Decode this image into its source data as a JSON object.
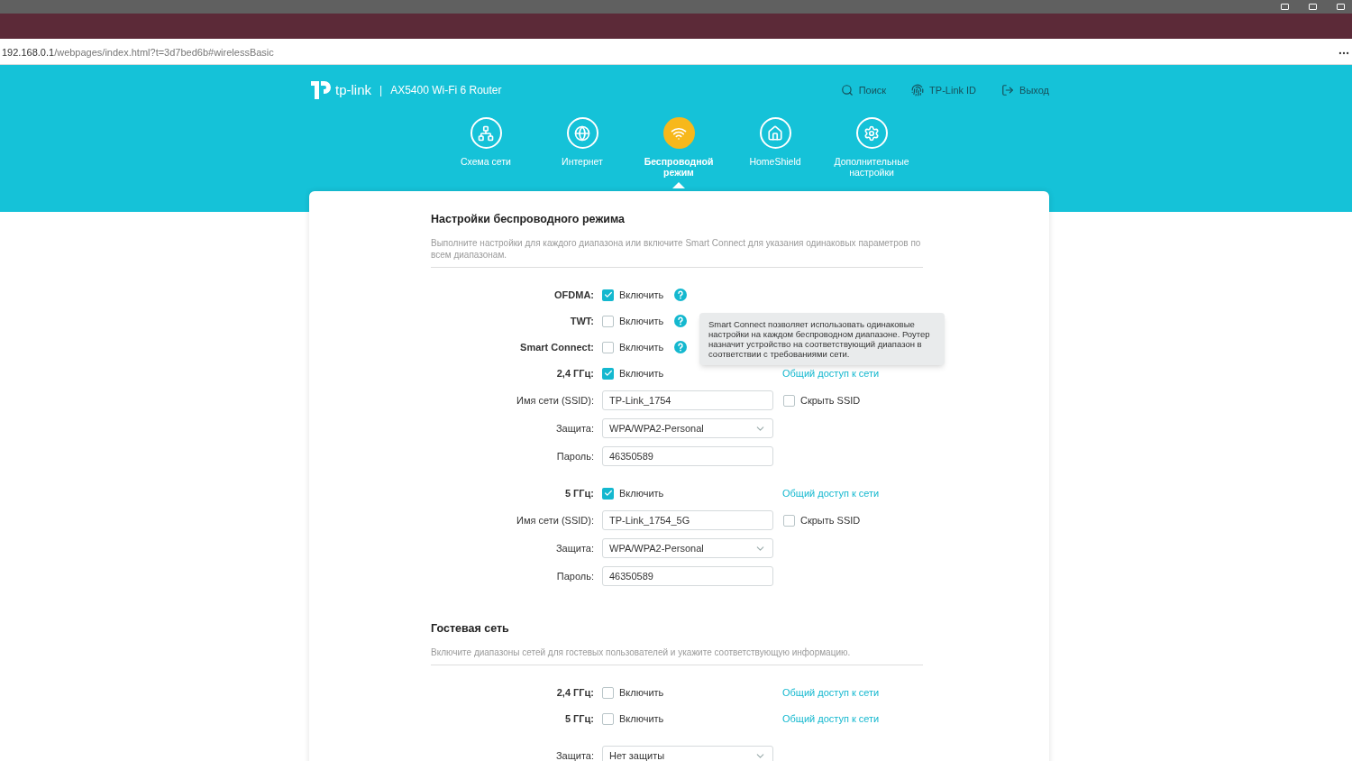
{
  "browser": {
    "url_host": "192.168.0.1",
    "url_path": "/webpages/index.html?t=3d7bed6b#wirelessBasic"
  },
  "header": {
    "logo_text": "tp-link",
    "separator": "|",
    "model": "AX5400 Wi-Fi 6 Router",
    "actions": [
      {
        "kind": "search",
        "label": "Поиск"
      },
      {
        "kind": "id",
        "label": "TP-Link ID"
      },
      {
        "kind": "logout",
        "label": "Выход"
      }
    ]
  },
  "nav": [
    {
      "kind": "network",
      "label": "Схема сети",
      "selected": false
    },
    {
      "kind": "internet",
      "label": "Интернет",
      "selected": false
    },
    {
      "kind": "wireless",
      "label": "Беспроводной режим",
      "selected": true
    },
    {
      "kind": "homeshield",
      "label": "HomeShield",
      "selected": false
    },
    {
      "kind": "advanced",
      "label": "Дополнительные настройки",
      "selected": false
    }
  ],
  "sections": [
    {
      "title": "Настройки беспроводного режима",
      "description": "Выполните настройки для каждого диапазона или включите Smart Connect для указания одинаковых параметров по всем диапазонам.",
      "groups": [
        [
          {
            "kind": "checkbox",
            "label": "OFDMA:",
            "checked": true,
            "option": "Включить",
            "help": true
          },
          {
            "kind": "checkbox",
            "label": "TWT:",
            "checked": false,
            "option": "Включить",
            "help": true
          },
          {
            "kind": "checkbox",
            "label": "Smart Connect:",
            "checked": false,
            "option": "Включить",
            "help": true,
            "tooltip": "Smart Connect позволяет использовать одинаковые настройки на каждом беспроводном диапазоне. Роутер назначит устройство на соответствующий диапазон в соответствии с требованиями сети."
          },
          {
            "kind": "checkbox",
            "label": "2,4 ГГц:",
            "checked": true,
            "option": "Включить",
            "link": "Общий доступ к сети"
          },
          {
            "kind": "input",
            "label": "Имя сети (SSID):",
            "value": "TP-Link_1754",
            "side_option": "Скрыть SSID",
            "side_checked": false
          },
          {
            "kind": "select",
            "label": "Защита:",
            "value": "WPA/WPA2-Personal"
          },
          {
            "kind": "input",
            "label": "Пароль:",
            "value": "46350589"
          }
        ],
        [
          {
            "kind": "checkbox",
            "label": "5 ГГц:",
            "checked": true,
            "option": "Включить",
            "link": "Общий доступ к сети"
          },
          {
            "kind": "input",
            "label": "Имя сети (SSID):",
            "value": "TP-Link_1754_5G",
            "side_option": "Скрыть SSID",
            "side_checked": false
          },
          {
            "kind": "select",
            "label": "Защита:",
            "value": "WPA/WPA2-Personal"
          },
          {
            "kind": "input",
            "label": "Пароль:",
            "value": "46350589"
          }
        ]
      ]
    },
    {
      "title": "Гостевая сеть",
      "description": "Включите диапазоны сетей для гостевых пользователей и укажите соответствующую информацию.",
      "groups": [
        [
          {
            "kind": "checkbox",
            "label": "2,4 ГГц:",
            "checked": false,
            "option": "Включить",
            "link": "Общий доступ к сети"
          },
          {
            "kind": "checkbox",
            "label": "5 ГГц:",
            "checked": false,
            "option": "Включить",
            "link": "Общий доступ к сети"
          }
        ],
        [
          {
            "kind": "select",
            "label": "Защита:",
            "value": "Нет защиты"
          }
        ]
      ]
    }
  ]
}
